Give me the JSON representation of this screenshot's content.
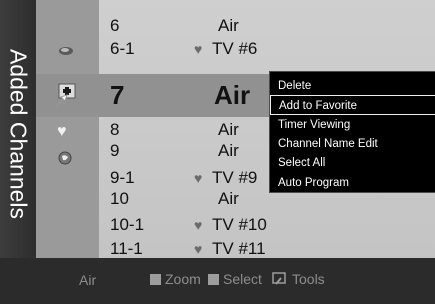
{
  "sidebar": {
    "title": "Added Channels"
  },
  "channels": [
    {
      "number": "6",
      "name": "Air",
      "favorite": false
    },
    {
      "number": "6-1",
      "name": "TV #6",
      "favorite": true
    },
    {
      "number": "7",
      "name": "Air",
      "favorite": false,
      "selected": true
    },
    {
      "number": "8",
      "name": "Air",
      "favorite": false
    },
    {
      "number": "9",
      "name": "Air",
      "favorite": false
    },
    {
      "number": "9-1",
      "name": "TV #9",
      "favorite": true
    },
    {
      "number": "10",
      "name": "Air",
      "favorite": false
    },
    {
      "number": "10-1",
      "name": "TV #10",
      "favorite": true
    },
    {
      "number": "11-1",
      "name": "TV #11",
      "favorite": true
    }
  ],
  "context_menu": {
    "items": [
      "Delete",
      "Add to Favorite",
      "Timer Viewing",
      "Channel Name Edit",
      "Select All",
      "Auto Program"
    ],
    "highlighted": "Add to Favorite"
  },
  "footer": {
    "source": "Air",
    "zoom": "Zoom",
    "select": "Select",
    "tools": "Tools"
  },
  "icons": {
    "source_row_6": "antenna-icon",
    "selected_row": "add-channel-icon",
    "favorite_filter": "heart-icon",
    "globe": "globe-icon",
    "tools": "tools-icon"
  },
  "colors": {
    "menu_bg": "#000000",
    "list_bg": "#cfcfcf",
    "band": "#919191",
    "text": "#111111"
  }
}
